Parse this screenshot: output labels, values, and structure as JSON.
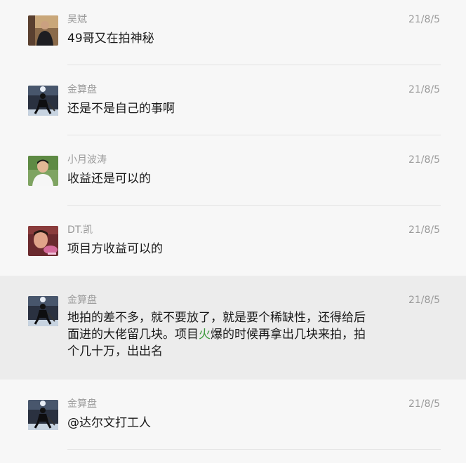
{
  "messages": [
    {
      "sender": "吴斌",
      "date": "21/8/5",
      "text": "49哥又在拍神秘",
      "avatar": "portrait-avatar-man-dark"
    },
    {
      "sender": "金算盘",
      "date": "21/8/5",
      "text": "还是不是自己的事啊",
      "avatar": "hockey-player-avatar"
    },
    {
      "sender": "小月波涛",
      "date": "21/8/5",
      "text": "收益还是可以的",
      "avatar": "portrait-avatar-man-white-shirt"
    },
    {
      "sender": "DT.凯",
      "date": "21/8/5",
      "text": "项目方收益可以的",
      "avatar": "portrait-avatar-man-red"
    },
    {
      "sender": "金算盘",
      "date": "21/8/5",
      "text_before": "地拍的差不多，就不要放了，就是要个稀缺性，还得给后面进的大佬留几块。项目",
      "text_green": "火",
      "text_after": "爆的时候再拿出几块来拍，拍个几十万，出出名",
      "avatar": "hockey-player-avatar",
      "highlighted": true
    },
    {
      "sender": "金算盘",
      "date": "21/8/5",
      "text": "@达尔文打工人",
      "avatar": "hockey-player-avatar"
    }
  ],
  "colors": {
    "green_highlight": "#3c9a3c",
    "highlight_bg": "#ececec"
  }
}
